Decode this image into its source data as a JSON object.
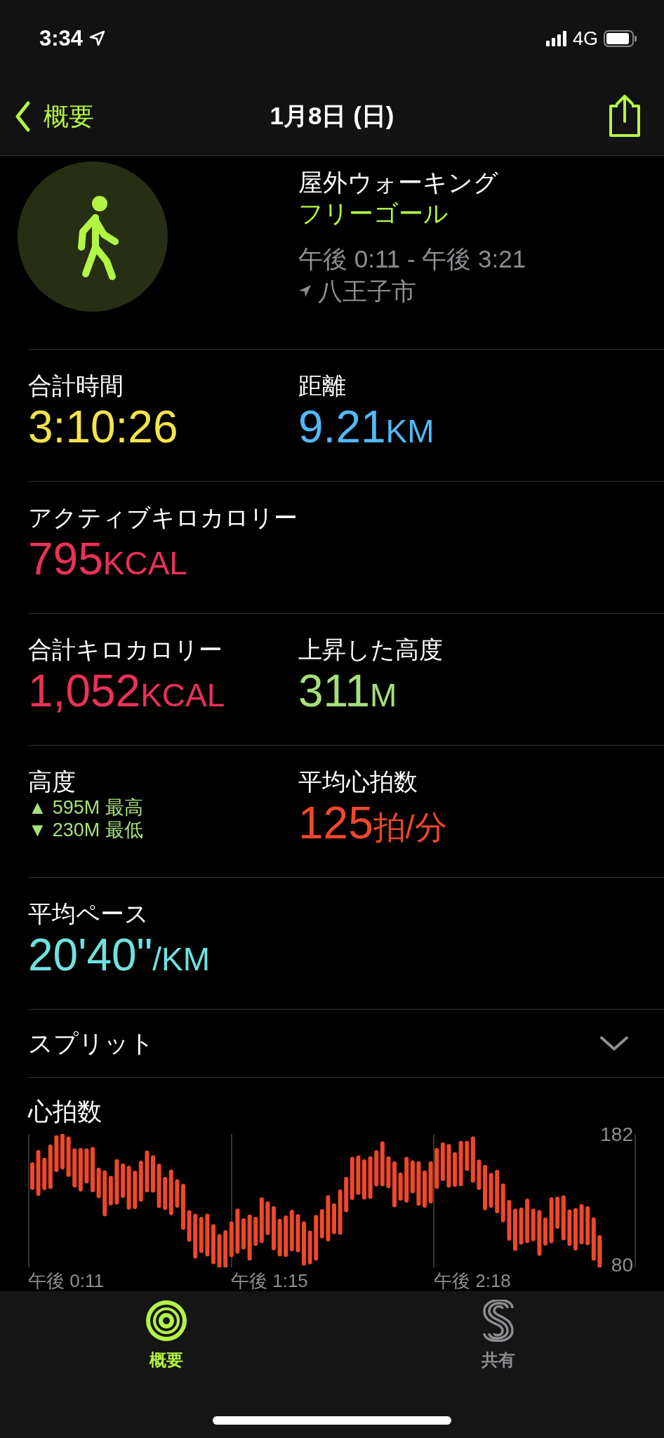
{
  "status_bar": {
    "time": "3:34",
    "network": "4G"
  },
  "nav": {
    "back_label": "概要",
    "title": "1月8日 (日)"
  },
  "workout": {
    "title": "屋外ウォーキング",
    "goal": "フリーゴール",
    "time_range": "午後 0:11 - 午後 3:21",
    "location": "八王子市"
  },
  "metric_rows": [
    {
      "cells": [
        {
          "kind": "value",
          "label": "合計時間",
          "value": "3:10:26",
          "color": "#f5e34b"
        },
        {
          "kind": "value",
          "label": "距離",
          "value": "9.21",
          "unit": "KM",
          "color": "#52b8f7"
        }
      ]
    },
    {
      "cells": [
        {
          "kind": "value",
          "label": "アクティブキロカロリー",
          "value": "795",
          "unit": "KCAL",
          "color": "#ea3159"
        }
      ]
    },
    {
      "cells": [
        {
          "kind": "value",
          "label": "合計キロカロリー",
          "value": "1,052",
          "unit": "KCAL",
          "color": "#ea3159"
        },
        {
          "kind": "value",
          "label": "上昇した高度",
          "value": "311",
          "unit": "M",
          "color": "#a6e07c"
        }
      ]
    },
    {
      "cells": [
        {
          "kind": "range",
          "label": "高度",
          "color": "#a6e07c",
          "lines": [
            {
              "arrow": "▲",
              "text": "595M 最高"
            },
            {
              "arrow": "▼",
              "text": "230M 最低"
            }
          ]
        },
        {
          "kind": "value",
          "label": "平均心拍数",
          "value": "125",
          "unit": "拍/分",
          "color": "#f0472c"
        }
      ]
    },
    {
      "cells": [
        {
          "kind": "value",
          "label": "平均ペース",
          "value": "20'40\"",
          "unit": "/KM",
          "color": "#6ee2e0"
        }
      ]
    }
  ],
  "split": {
    "label": "スプリット",
    "expanded": false
  },
  "heart_rate": {
    "title": "心拍数",
    "y_max": "182",
    "y_min": "80",
    "x_labels": [
      "午後 0:11",
      "午後 1:15",
      "午後 2:18"
    ]
  },
  "tabs": [
    {
      "label": "概要",
      "selected": true,
      "kind": "rings"
    },
    {
      "label": "共有",
      "selected": false,
      "kind": "sharing"
    }
  ]
}
